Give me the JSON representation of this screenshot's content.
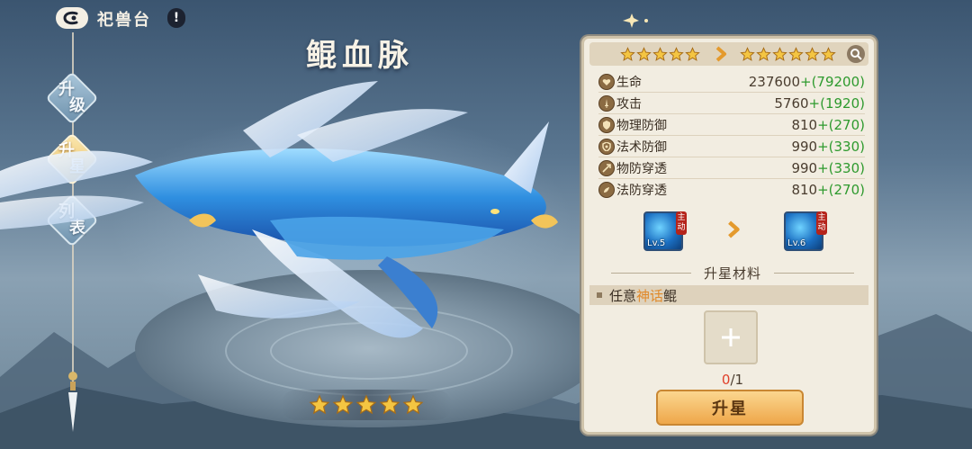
{
  "header": {
    "title": "祀兽台",
    "info_label": "!"
  },
  "nav": {
    "tabs": [
      {
        "label_line1": "升",
        "label_line2": "级"
      },
      {
        "label_line1": "升",
        "label_line2": "星"
      },
      {
        "label_line1": "列",
        "label_line2": "表"
      }
    ],
    "active_tab": 1
  },
  "beast": {
    "name": "鲲血脉",
    "star_count": 5
  },
  "panel": {
    "current_stars": 5,
    "next_stars": 6,
    "stats": [
      {
        "icon": "heart-icon",
        "name": "生命",
        "value": "237600",
        "bonus": "+(79200)"
      },
      {
        "icon": "sword-icon",
        "name": "攻击",
        "value": "5760",
        "bonus": "+(1920)"
      },
      {
        "icon": "shield-icon",
        "name": "物理防御",
        "value": "810",
        "bonus": "+(270)"
      },
      {
        "icon": "magic-shield-icon",
        "name": "法术防御",
        "value": "990",
        "bonus": "+(330)"
      },
      {
        "icon": "pierce-icon",
        "name": "物防穿透",
        "value": "990",
        "bonus": "+(330)"
      },
      {
        "icon": "magic-pierce-icon",
        "name": "法防穿透",
        "value": "810",
        "bonus": "+(270)"
      }
    ],
    "skill_from": {
      "level": "Lv.5",
      "tag_top": "主",
      "tag_bottom": "动"
    },
    "skill_to": {
      "level": "Lv.6",
      "tag_top": "主",
      "tag_bottom": "动"
    },
    "materials_title": "升星材料",
    "requirement": {
      "prefix": "任意",
      "highlight": "神话",
      "suffix": "鲲"
    },
    "count": {
      "current": "0",
      "total": "/1"
    },
    "upgrade_label": "升星"
  },
  "colors": {
    "gold": "#e0a83a",
    "bonus_green": "#2e9a2e",
    "highlight_orange": "#e0892a"
  }
}
